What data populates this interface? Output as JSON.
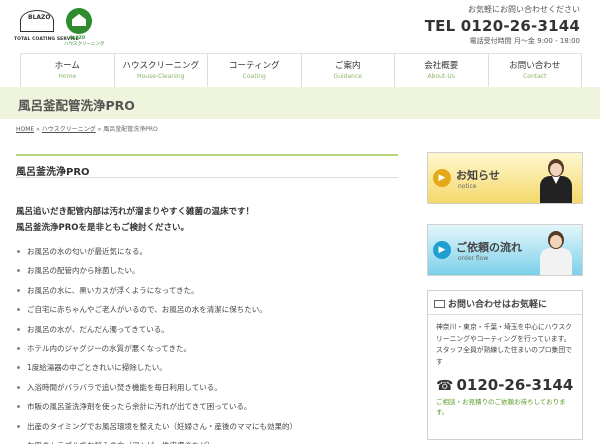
{
  "header": {
    "logo_main_text": "BLAZO",
    "logo_main_sub": "TOTAL COATING SERVICE",
    "logo_house_text": "BLAZO",
    "logo_house_sub": "ハウスクリーニング",
    "inquiry_text": "お気軽にお問い合わせください",
    "tel": "TEL 0120-26-3144",
    "hours": "電話受付時間 月〜金 9:00 - 18:00"
  },
  "nav": [
    {
      "jp": "ホーム",
      "en": "Home"
    },
    {
      "jp": "ハウスクリーニング",
      "en": "House-Cleaning"
    },
    {
      "jp": "コーティング",
      "en": "Coating"
    },
    {
      "jp": "ご案内",
      "en": "Guidance"
    },
    {
      "jp": "会社概要",
      "en": "About-Us"
    },
    {
      "jp": "お問い合わせ",
      "en": "Contact"
    }
  ],
  "page_title": "風呂釜配管洗浄PRO",
  "breadcrumb": {
    "home": "HOME",
    "sep": " » ",
    "section": "ハウスクリーニング",
    "current": "風呂釜配管洗浄PRO"
  },
  "main": {
    "heading": "風呂釜洗浄PRO",
    "lead_line1": "風呂追いだき配管内部は汚れが溜まりやすく雑菌の温床です！",
    "lead_line2": "風呂釜洗浄PROを是非ともご検討ください。",
    "items": [
      "お風呂の水の匂いが最近気になる。",
      "お風呂の配管内から除菌したい。",
      "お風呂の水に、黒いカスが浮くようになってきた。",
      "ご自宅に赤ちゃんやご老人がいるので、お風呂の水を清潔に保ちたい。",
      "お風呂の水が、だんだん濁ってきている。",
      "ホテル内のジャグジーの水質が悪くなってきた。",
      "1度給湯器の中ごときれいに掃除したい。",
      "入浴時間がバラバラで追い焚き機能を毎日利用している。",
      "市販の風呂釜洗浄剤を使ったら余計に汚れが出てきて困っている。",
      "出産のタイミングでお風呂環境を整えたい（妊婦さん・産後のママにも効果的）",
      "お肌のトラブルでお悩みの方（アトピー性皮膚炎など）"
    ]
  },
  "sidebar": {
    "news_jp": "お知らせ",
    "news_en": "notice",
    "flow_jp": "ご依頼の流れ",
    "flow_en": "order flow",
    "inquiry_title": "お問い合わせはお気軽に",
    "inquiry_text": "神奈川・東京・千葉・埼玉を中心にハウスクリーニングやコーティングを行っています。スタッフ全員が熟練した住まいのプロ集団です",
    "tel": "0120-26-3144",
    "note": "ご相談・お見積りのご依頼お待ちしております。"
  }
}
